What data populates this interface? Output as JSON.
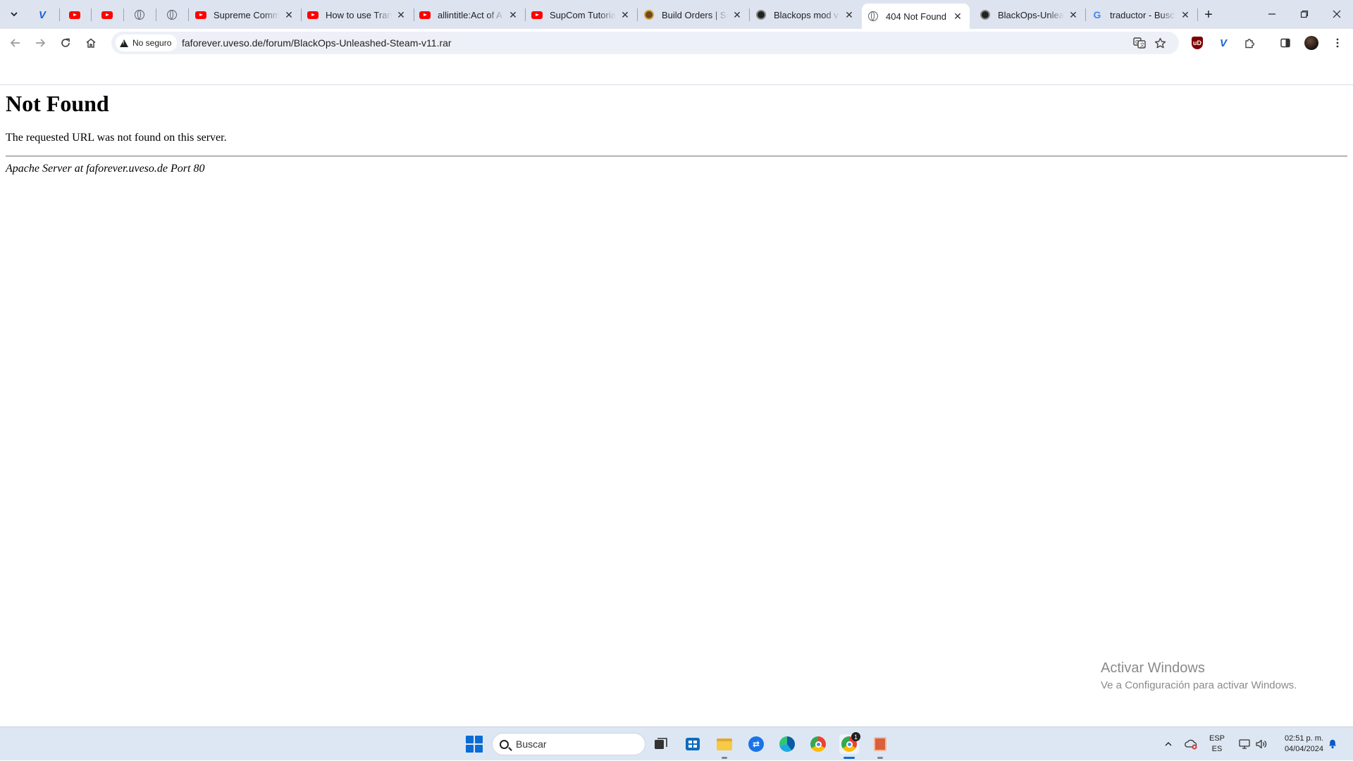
{
  "browser": {
    "tabs": [
      {
        "type": "pinned",
        "favicon": "v-logo-icon",
        "label": ""
      },
      {
        "type": "pinned",
        "favicon": "youtube-icon",
        "label": ""
      },
      {
        "type": "pinned",
        "favicon": "youtube-icon",
        "label": ""
      },
      {
        "type": "pinned",
        "favicon": "globe-icon",
        "label": ""
      },
      {
        "type": "pinned",
        "favicon": "globe-icon",
        "label": ""
      },
      {
        "type": "normal",
        "favicon": "youtube-icon",
        "label": "Supreme Comm"
      },
      {
        "type": "normal",
        "favicon": "youtube-icon",
        "label": "How to use Tran"
      },
      {
        "type": "normal",
        "favicon": "youtube-icon",
        "label": "allintitle:Act of A"
      },
      {
        "type": "normal",
        "favicon": "youtube-icon",
        "label": "SupCom Tutorial"
      },
      {
        "type": "normal",
        "favicon": "build-orders-icon",
        "label": "Build Orders | Su"
      },
      {
        "type": "normal",
        "favicon": "blackops-icon",
        "label": "Blackops mod v"
      },
      {
        "type": "active",
        "favicon": "globe-icon",
        "label": "404 Not Found"
      },
      {
        "type": "normal",
        "favicon": "blackops-icon",
        "label": "BlackOps-Unleas"
      },
      {
        "type": "normal",
        "favicon": "google-icon",
        "label": "traductor - Busc"
      }
    ],
    "security_chip": "No seguro",
    "url": "faforever.uveso.de/forum/BlackOps-Unleashed-Steam-v11.rar"
  },
  "page": {
    "title": "Not Found",
    "message": "The requested URL was not found on this server.",
    "address": "Apache Server at faforever.uveso.de Port 80"
  },
  "watermark": {
    "line1": "Activar Windows",
    "line2": "Ve a Configuración para activar Windows."
  },
  "taskbar": {
    "search_placeholder": "Buscar",
    "lang_top": "ESP",
    "lang_bottom": "ES",
    "time": "02:51 p. m.",
    "date": "04/04/2024",
    "chrome_badge": "1"
  }
}
